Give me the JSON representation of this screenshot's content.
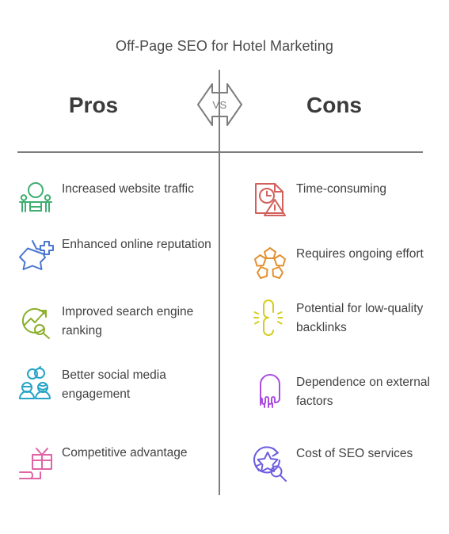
{
  "title": "Off-Page SEO for Hotel Marketing",
  "center_badge": {
    "label": "VS",
    "icon": "vs-hexagon-icon",
    "color": "#7d7d7d"
  },
  "columns": {
    "pros": {
      "heading": "Pros",
      "items": [
        {
          "label": "Increased website traffic",
          "icon": "reception-desk-people-icon",
          "color": "#3fae70"
        },
        {
          "label": "Enhanced online reputation",
          "icon": "star-plus-icon",
          "color": "#4a77d0"
        },
        {
          "label": "Improved search engine ranking",
          "icon": "magnifier-growth-arrow-icon",
          "color": "#8aaf2b"
        },
        {
          "label": "Better social media engagement",
          "icon": "two-people-link-icon",
          "color": "#26a4c8"
        },
        {
          "label": "Competitive advantage",
          "icon": "gift-on-hand-icon",
          "color": "#e063a6"
        }
      ]
    },
    "cons": {
      "heading": "Cons",
      "items": [
        {
          "label": "Time-consuming",
          "icon": "document-clock-warning-icon",
          "color": "#d2605c"
        },
        {
          "label": "Requires ongoing effort",
          "icon": "segmented-wheel-icon",
          "color": "#e2902f"
        },
        {
          "label": "Potential for low-quality backlinks",
          "icon": "broken-chain-link-icon",
          "color": "#d8cc1f"
        },
        {
          "label": "Dependence on external factors",
          "icon": "puppet-hand-icon",
          "color": "#ab4ee0"
        },
        {
          "label": "Cost of SEO services",
          "icon": "magnifier-star-refresh-icon",
          "color": "#6d5ee0"
        }
      ]
    }
  },
  "theme": {
    "background": "#ffffff",
    "text": "#414141",
    "title_text": "#4a4a4a",
    "heading_text": "#3b3b3b",
    "divider": "#7d7d7d"
  }
}
